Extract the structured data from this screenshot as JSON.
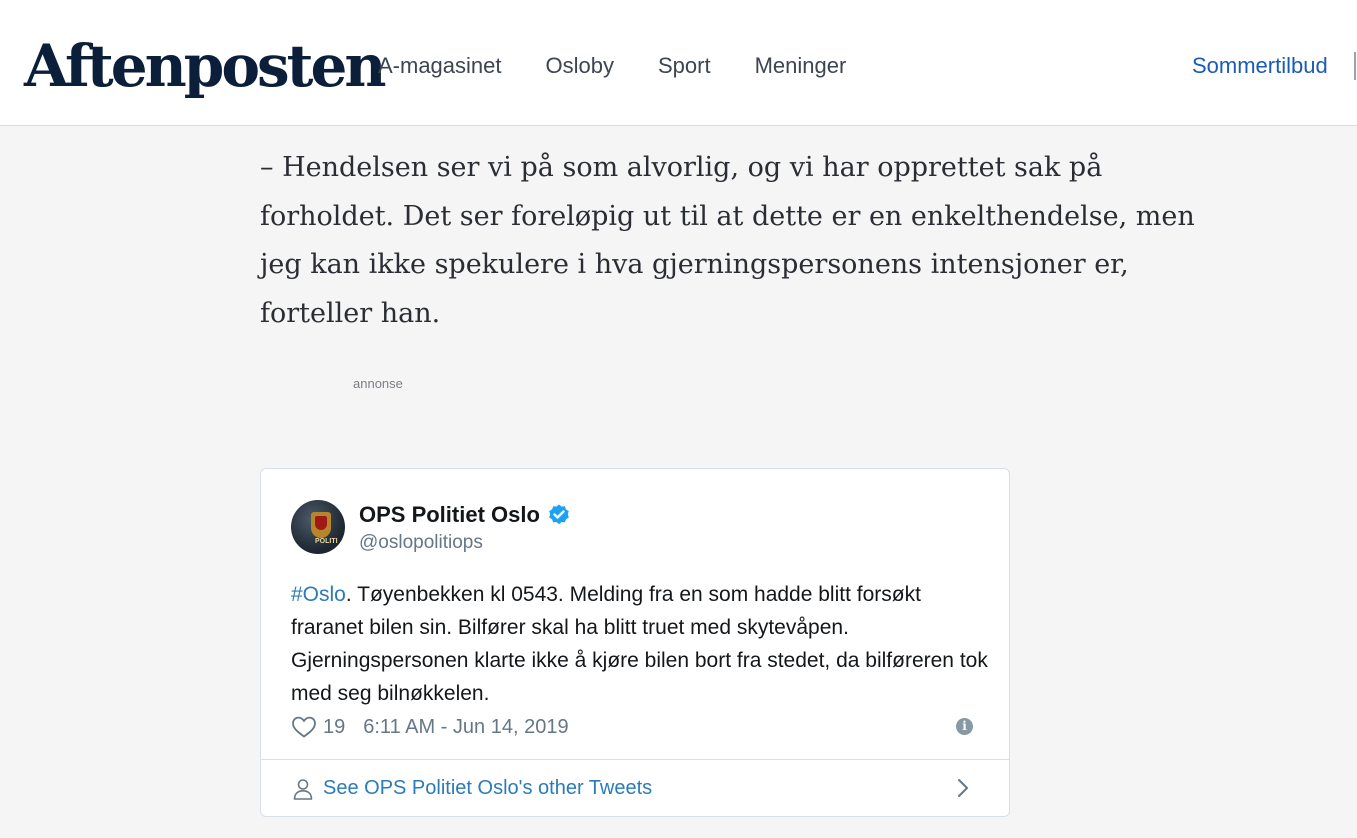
{
  "header": {
    "logo": "Aftenposten",
    "nav": [
      "A-magasinet",
      "Osloby",
      "Sport",
      "Meninger"
    ],
    "promo": "Sommertilbud"
  },
  "article": {
    "paragraph": "– Hendelsen ser vi på som alvorlig, og vi har opprettet sak på forholdet. Det ser foreløpig ut til at dette er en enkelthendelse, men jeg kan ikke spekulere i hva gjerningspersonens intensjoner er, forteller han.",
    "ad_label": "annonse"
  },
  "tweet": {
    "name": "OPS Politiet Oslo",
    "handle": "@oslopolitiops",
    "avatar_text": "POLITI",
    "hashtag": "#Oslo",
    "body": ". Tøyenbekken kl 0543. Melding fra en som hadde blitt forsøkt fraranet bilen sin. Bilfører skal ha blitt truet med skytevåpen. Gjerningspersonen klarte ikke å kjøre bilen bort fra stedet, da bilføreren tok med seg bilnøkkelen.",
    "likes": "19",
    "timestamp": "6:11 AM - Jun 14, 2019",
    "info_glyph": "i",
    "footer_link": "See OPS Politiet Oslo's other Tweets"
  },
  "colors": {
    "brand_navy": "#0b1f3a",
    "promo_blue": "#1a5bb8",
    "twitter_blue": "#2b7bb9",
    "verified_blue": "#1da1f2"
  }
}
